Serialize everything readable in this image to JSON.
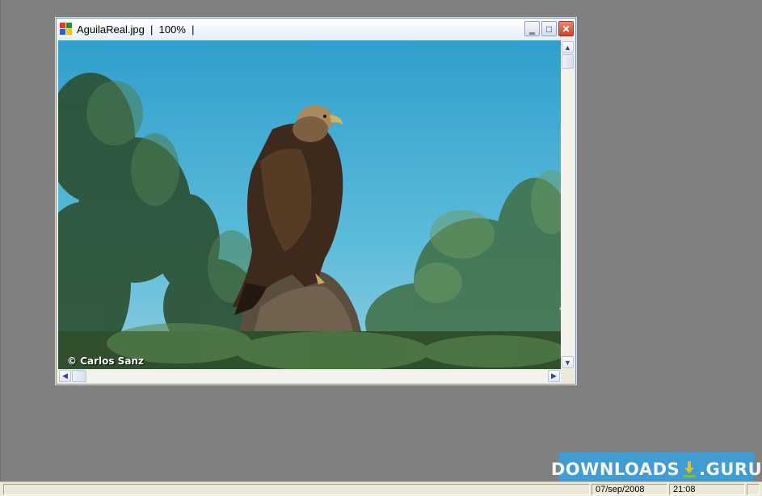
{
  "window": {
    "title": "AguilaReal.jpg  |  100%  |",
    "buttons": {
      "minimize": "‗",
      "maximize": "□",
      "close": "✕"
    }
  },
  "image": {
    "credit": "© Carlos Sanz"
  },
  "scrollbars": {
    "up": "▲",
    "down": "▼",
    "left": "◀",
    "right": "▶"
  },
  "watermark": {
    "left_text": "DOWNLOADS",
    "right_text": ".GURU"
  },
  "statusbar": {
    "date": "07/sep/2008",
    "time": "21:08"
  },
  "colors": {
    "desktop": "#808080",
    "sky": "#3aa6cf",
    "watermark": "#3b9fd8",
    "close_button": "#c6462c"
  }
}
